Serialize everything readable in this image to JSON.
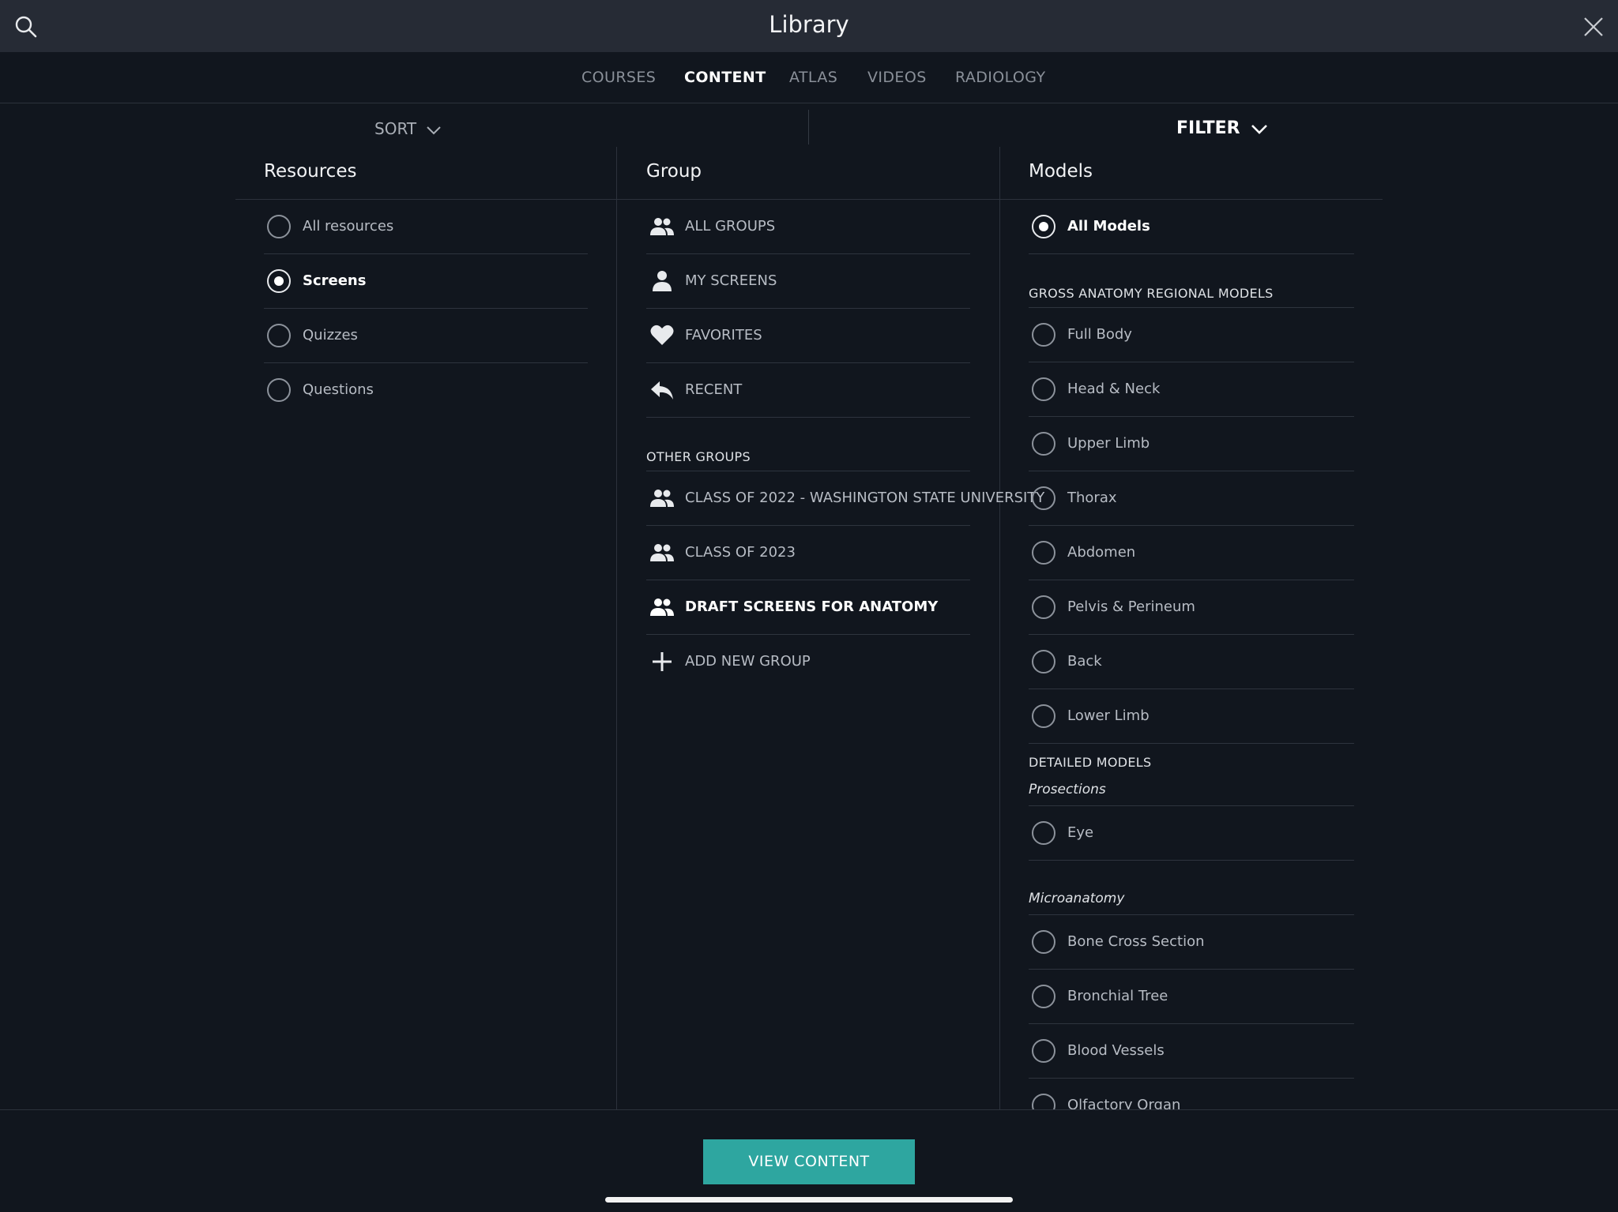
{
  "header": {
    "title": "Library"
  },
  "tabs": [
    "COURSES",
    "CONTENT",
    "ATLAS",
    "VIDEOS",
    "RADIOLOGY"
  ],
  "active_tab": "CONTENT",
  "toolbar": {
    "sort_label": "SORT",
    "filter_label": "FILTER"
  },
  "resources": {
    "title": "Resources",
    "items": [
      {
        "label": "All resources",
        "selected": false
      },
      {
        "label": "Screens",
        "selected": true
      },
      {
        "label": "Quizzes",
        "selected": false
      },
      {
        "label": "Questions",
        "selected": false
      }
    ]
  },
  "group": {
    "title": "Group",
    "items": [
      {
        "label": "ALL GROUPS",
        "icon": "people-icon"
      },
      {
        "label": "MY SCREENS",
        "icon": "person-icon"
      },
      {
        "label": "FAVORITES",
        "icon": "heart-icon"
      },
      {
        "label": "RECENT",
        "icon": "reply-arrow-icon"
      }
    ],
    "other_title": "OTHER GROUPS",
    "other_items": [
      {
        "label": "CLASS OF 2022 - WASHINGTON STATE UNIVERSITY",
        "icon": "people-icon",
        "selected": false
      },
      {
        "label": "CLASS OF 2023",
        "icon": "people-icon",
        "selected": false
      },
      {
        "label": "DRAFT SCREENS FOR ANATOMY",
        "icon": "people-icon",
        "selected": true
      },
      {
        "label": "ADD NEW GROUP",
        "icon": "plus-icon",
        "selected": false
      }
    ]
  },
  "models": {
    "title": "Models",
    "all_label": "All Models",
    "gross_title": "GROSS ANATOMY REGIONAL MODELS",
    "gross_items": [
      "Full Body",
      "Head & Neck",
      "Upper Limb",
      "Thorax",
      "Abdomen",
      "Pelvis & Perineum",
      "Back",
      "Lower Limb"
    ],
    "detailed_title": "DETAILED MODELS",
    "prosections_title": "Prosections",
    "prosections_items": [
      "Eye"
    ],
    "micro_title": "Microanatomy",
    "micro_items": [
      "Bone Cross Section",
      "Bronchial Tree",
      "Blood Vessels",
      "Olfactory Organ"
    ]
  },
  "footer": {
    "view_button": "VIEW CONTENT"
  }
}
